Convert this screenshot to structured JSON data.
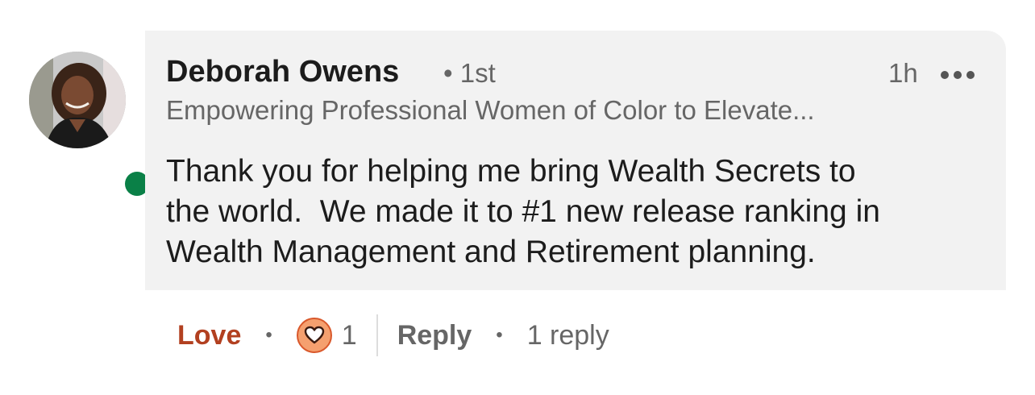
{
  "comment": {
    "author": {
      "name": "Deborah Owens",
      "degree": "• 1st",
      "headline": "Empowering Professional Women of Color to Elevate...",
      "avatar_icon": "profile-photo",
      "online": true,
      "presence_color": "#0a8047"
    },
    "time": "1h",
    "more_icon": "ellipsis-icon",
    "text": "Thank you for helping me bring Wealth Secrets to\nthe world.  We made it to #1 new release ranking in\nWealth Management and Retirement planning."
  },
  "actions": {
    "reaction_label": "Love",
    "separator": "•",
    "reaction_icon": "heart-icon",
    "reaction_count": "1",
    "reply_label": "Reply",
    "reply_count": "1 reply",
    "reaction_color": "#b24020"
  }
}
